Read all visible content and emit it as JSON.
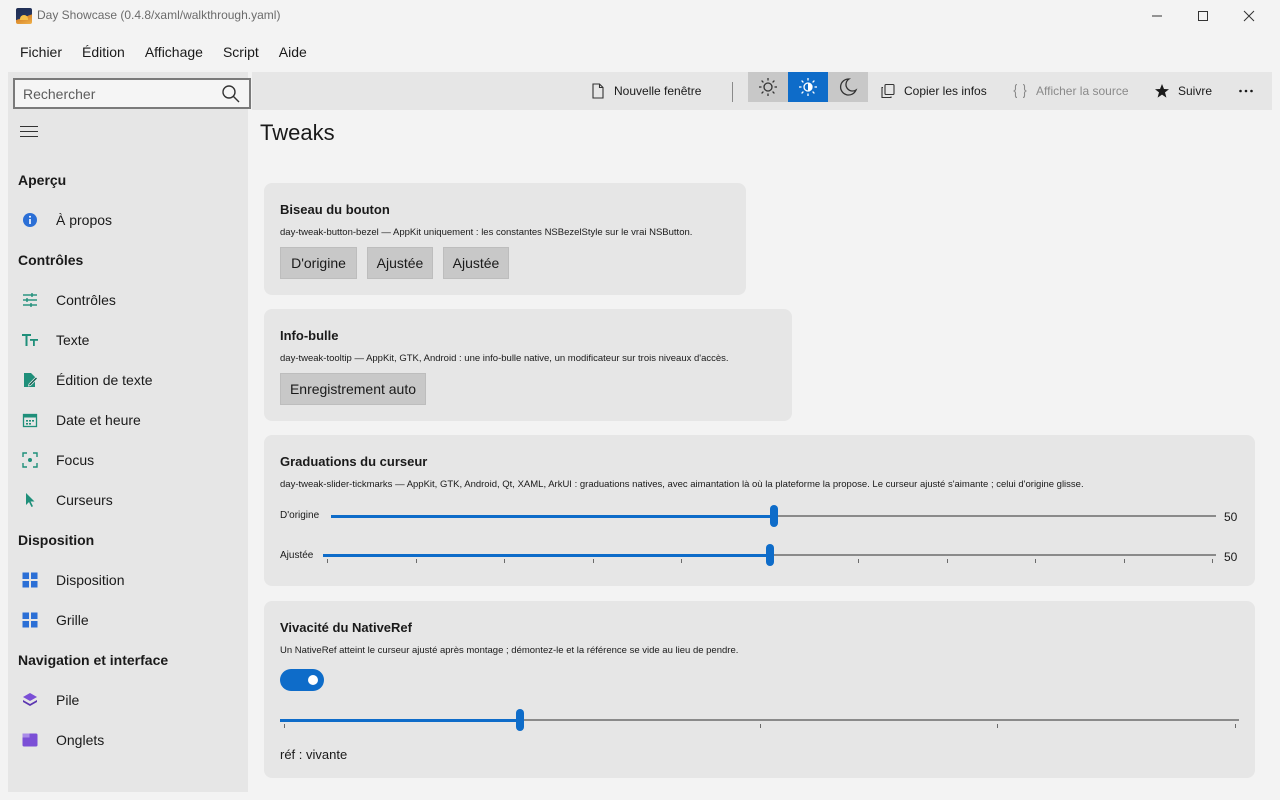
{
  "window": {
    "title": "Day Showcase (0.4.8/xaml/walkthrough.yaml)"
  },
  "menu": [
    "Fichier",
    "Édition",
    "Affichage",
    "Script",
    "Aide"
  ],
  "search": {
    "placeholder": "Rechercher",
    "value": ""
  },
  "sidebar": {
    "sections": [
      {
        "title": "Aperçu",
        "items": [
          {
            "label": "À propos",
            "icon": "info-icon"
          }
        ]
      },
      {
        "title": "Contrôles",
        "items": [
          {
            "label": "Contrôles",
            "icon": "sliders-icon"
          },
          {
            "label": "Texte",
            "icon": "text-icon"
          },
          {
            "label": "Édition de texte",
            "icon": "edit-document-icon"
          },
          {
            "label": "Date et heure",
            "icon": "calendar-icon"
          },
          {
            "label": "Focus",
            "icon": "focus-icon"
          },
          {
            "label": "Curseurs",
            "icon": "cursor-icon"
          }
        ]
      },
      {
        "title": "Disposition",
        "items": [
          {
            "label": "Disposition",
            "icon": "layout-icon"
          },
          {
            "label": "Grille",
            "icon": "grid-icon"
          }
        ]
      },
      {
        "title": "Navigation et interface",
        "items": [
          {
            "label": "Pile",
            "icon": "stack-icon"
          },
          {
            "label": "Onglets",
            "icon": "tabs-icon"
          }
        ]
      }
    ]
  },
  "toolbar": {
    "new_window": "Nouvelle fenêtre",
    "copy_info": "Copier les infos",
    "show_source": "Afficher la source",
    "follow": "Suivre",
    "theme_active": "auto"
  },
  "page": {
    "title": "Tweaks",
    "cards": {
      "bezel": {
        "title": "Biseau du bouton",
        "desc": "day-tweak-button-bezel — AppKit uniquement : les constantes NSBezelStyle sur le vrai NSButton.",
        "buttons": [
          "D'origine",
          "Ajustée",
          "Ajustée"
        ]
      },
      "tooltip": {
        "title": "Info-bulle",
        "desc": "day-tweak-tooltip — AppKit, GTK, Android : une info-bulle native, un modificateur sur trois niveaux d'accès.",
        "button": "Enregistrement auto"
      },
      "ticks": {
        "title": "Graduations du curseur",
        "desc": "day-tweak-slider-tickmarks — AppKit, GTK, Android, Qt, XAML, ArkUI : graduations natives, avec aimantation là où la plateforme la propose. Le curseur ajusté s'aimante ; celui d'origine glisse.",
        "slider1": {
          "label": "D'origine",
          "value": 50,
          "display": "50",
          "min": 0,
          "max": 100
        },
        "slider2": {
          "label": "Ajustée",
          "value": 50,
          "display": "50",
          "min": 0,
          "max": 100,
          "tick_count": 11
        }
      },
      "nativeref": {
        "title": "Vivacité du NativeRef",
        "desc": "Un NativeRef atteint le curseur ajusté après montage ; démontez-le et la référence se vide au lieu de pendre.",
        "toggle_on": true,
        "slider": {
          "value": 25,
          "min": 0,
          "max": 100,
          "tick_count": 5
        },
        "status": "réf : vivante"
      }
    }
  },
  "colors": {
    "accent": "#0e6cc9",
    "card": "#e6e6e6",
    "background": "#f3f3f3"
  }
}
